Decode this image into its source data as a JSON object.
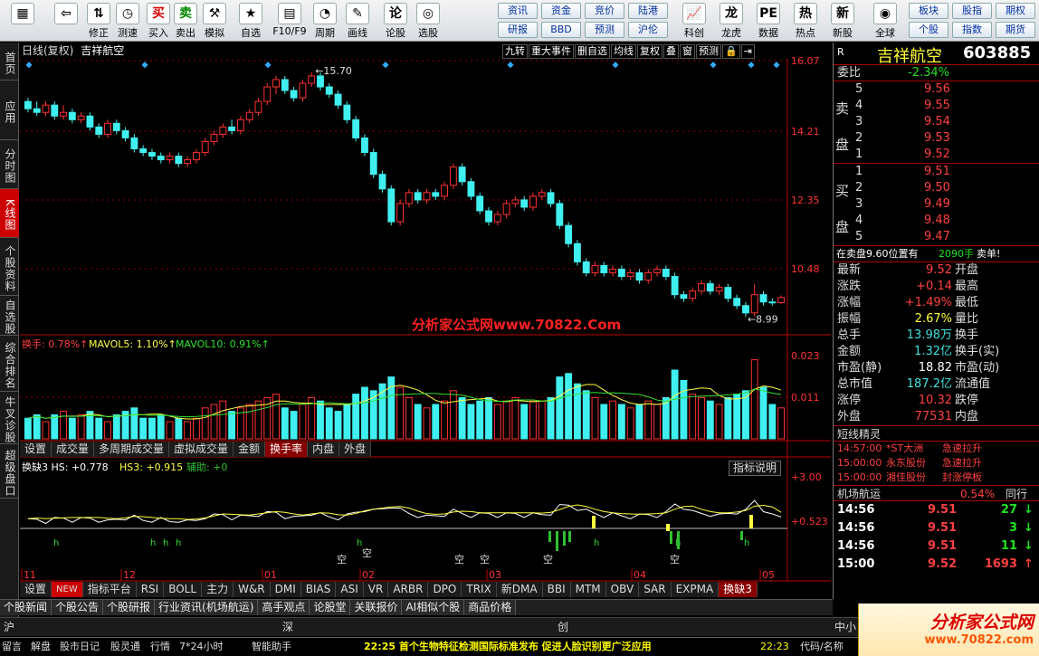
{
  "toolbar": {
    "buttons": [
      {
        "label": "",
        "icon": "grid-icon"
      },
      {
        "label": "",
        "icon": "back-icon"
      },
      {
        "label": "修正",
        "icon": "up-down-icon"
      },
      {
        "label": "测速",
        "icon": "clock-icon"
      },
      {
        "label": "买入",
        "icon": "buy-icon"
      },
      {
        "label": "卖出",
        "icon": "sell-icon"
      },
      {
        "label": "模拟",
        "icon": "hammer-icon"
      },
      {
        "label": "自选",
        "icon": "star-icon"
      },
      {
        "label": "F10/F9",
        "icon": "f10-icon"
      },
      {
        "label": "周期",
        "icon": "cycle-icon"
      },
      {
        "label": "画线",
        "icon": "pencil-icon"
      },
      {
        "label": "论股",
        "icon": "talk-icon"
      },
      {
        "label": "选股",
        "icon": "filter-icon"
      }
    ],
    "small": [
      "资讯",
      "资金",
      "竞价",
      "陆港",
      "研报",
      "BBD",
      "预测",
      "沪伦"
    ],
    "right_buttons": [
      {
        "label": "科创",
        "icon": "chart-icon"
      },
      {
        "label": "龙虎",
        "icon": "dragon-icon"
      },
      {
        "label": "数据",
        "icon": "pe-icon"
      },
      {
        "label": "热点",
        "icon": "hot-icon"
      },
      {
        "label": "新股",
        "icon": "ipo-icon"
      },
      {
        "label": "全球",
        "icon": "globe-icon"
      }
    ],
    "far": [
      "板块",
      "股指",
      "期权",
      "个股",
      "指数",
      "期货"
    ]
  },
  "leftbar": [
    "首页",
    "应用",
    "分时图",
    "K线图",
    "个股资料",
    "自选股",
    "综合排名",
    "牛叉诊股",
    "超级盘口"
  ],
  "kline": {
    "period": "日线(复权)",
    "name": "吉祥航空",
    "buttons": [
      "九转",
      "重大事件",
      "删自选",
      "均线",
      "复权",
      "叠",
      "窗",
      "预测"
    ],
    "high_label": "15.70",
    "low_label": "8.99",
    "yaxis": [
      "16.07",
      "14.21",
      "12.35",
      "10.48"
    ]
  },
  "turnover": {
    "title": "换手: 0.78%",
    "mavol5": "MAVOL5: 1.10%",
    "mavol10": "MAVOL10: 0.91%",
    "yaxis": [
      "0.023",
      "0.011"
    ]
  },
  "volume_tabs": [
    "设置",
    "成交量",
    "多周期成交量",
    "虚拟成交量",
    "金额",
    "换手率",
    "内盘",
    "外盘"
  ],
  "indicator": {
    "title": "换缺3 HS: +0.778",
    "hs3": "HS3: +0.915",
    "aux": "辅助: +0",
    "button": "指标说明",
    "yaxis": [
      "+3.00",
      "+0.523"
    ],
    "marks": [
      "空",
      "空",
      "空",
      "空",
      "空"
    ],
    "x_axis": [
      "11",
      "12",
      "01",
      "02",
      "03",
      "04",
      "05"
    ]
  },
  "indicator_tabs": [
    "设置",
    "NEW",
    "指标平台",
    "RSI",
    "BOLL",
    "主力",
    "W&R",
    "DMI",
    "BIAS",
    "ASI",
    "VR",
    "ARBR",
    "DPO",
    "TRIX",
    "新DMA",
    "BBI",
    "MTM",
    "OBV",
    "SAR",
    "EXPMA",
    "换缺3"
  ],
  "bottom_tabs": [
    "个股新闻",
    "个股公告",
    "个股研报",
    "行业资讯(机场航运)",
    "高手观点",
    "论股堂",
    "关联报价",
    "AI相似个股",
    "商品价格"
  ],
  "watermark": "分析家公式网www.70822.Com",
  "stock": {
    "title": "吉祥航空",
    "code": "603885",
    "wb_label": "委比",
    "wb": "-2.34%",
    "sell": [
      [
        "5",
        "9.56"
      ],
      [
        "4",
        "9.55"
      ],
      [
        "3",
        "9.54"
      ],
      [
        "2",
        "9.53"
      ],
      [
        "1",
        "9.52"
      ]
    ],
    "buy": [
      [
        "1",
        "9.51"
      ],
      [
        "2",
        "9.50"
      ],
      [
        "3",
        "9.49"
      ],
      [
        "4",
        "9.48"
      ],
      [
        "5",
        "9.47"
      ]
    ],
    "sell_side": "卖盘",
    "buy_side": "买盘",
    "sellbar": "在卖盘9.60位置有",
    "sellbar_qty": "2090手",
    "sellbar_action": "卖单!"
  },
  "quote": [
    {
      "k": "最新",
      "v": "9.52",
      "c": "red",
      "k2": "开盘"
    },
    {
      "k": "涨跌",
      "v": "+0.14",
      "c": "red",
      "k2": "最高"
    },
    {
      "k": "涨幅",
      "v": "+1.49%",
      "c": "red",
      "k2": "最低"
    },
    {
      "k": "振幅",
      "v": "2.67%",
      "c": "yel",
      "k2": "量比"
    },
    {
      "k": "总手",
      "v": "13.98万",
      "c": "cyan",
      "k2": "换手"
    },
    {
      "k": "金额",
      "v": "1.32亿",
      "c": "cyan",
      "k2": "换手(实)"
    },
    {
      "k": "市盈(静)",
      "v": "18.82",
      "c": "white",
      "k2": "市盈(动)"
    },
    {
      "k": "总市值",
      "v": "187.2亿",
      "c": "cyan",
      "k2": "流通值"
    },
    {
      "k": "涨停",
      "v": "10.32",
      "c": "red",
      "k2": "跌停"
    },
    {
      "k": "外盘",
      "v": "77531",
      "c": "red",
      "k2": "内盘"
    }
  ],
  "news": {
    "title": "短线精灵",
    "items": [
      [
        "14:57:00",
        "*ST大洲",
        "急速拉升"
      ],
      [
        "15:00:00",
        "永东股份",
        "急速拉升"
      ],
      [
        "15:00:00",
        "湘佳股份",
        "封涨停板"
      ]
    ]
  },
  "sector": {
    "label": "机场航运",
    "value": "0.54%",
    "extra": "同行"
  },
  "ticks": [
    [
      "14:56",
      "9.51",
      "27",
      "down"
    ],
    [
      "14:56",
      "9.51",
      "3",
      "down"
    ],
    [
      "14:56",
      "9.51",
      "11",
      "down"
    ],
    [
      "15:00",
      "9.52",
      "1693",
      "up"
    ]
  ],
  "market": {
    "sh": "沪",
    "sz": "深",
    "cy": "创",
    "zx": "中小"
  },
  "status": {
    "items": [
      "留言",
      "解盘",
      "股市日记",
      "股灵通",
      "行情",
      "7*24小时",
      "智能助手"
    ],
    "news": "22:25 首个生物特征检测国际标准发布 促进人脸识别更广泛应用",
    "time": "22:23",
    "code_label": "代码/名称"
  },
  "logo": {
    "text": "分析家公式网",
    "url": "www.70822.com"
  },
  "chart_data": {
    "type": "candlestick",
    "note_high": "15.70",
    "note_low": "8.99",
    "yrange": [
      8.5,
      16.07
    ],
    "candles": [
      [
        14.9,
        14.7,
        15.0,
        14.6
      ],
      [
        14.7,
        14.6,
        14.9,
        14.5
      ],
      [
        14.6,
        14.8,
        14.9,
        14.5
      ],
      [
        14.8,
        14.5,
        14.9,
        14.4
      ],
      [
        14.5,
        14.6,
        14.8,
        14.4
      ],
      [
        14.6,
        14.4,
        14.7,
        14.3
      ],
      [
        14.4,
        14.5,
        14.6,
        14.3
      ],
      [
        14.5,
        14.2,
        14.6,
        14.1
      ],
      [
        14.2,
        14.0,
        14.3,
        13.9
      ],
      [
        14.0,
        14.3,
        14.4,
        13.9
      ],
      [
        14.3,
        14.1,
        14.4,
        14.0
      ],
      [
        14.1,
        13.9,
        14.2,
        13.8
      ],
      [
        13.9,
        13.6,
        14.0,
        13.5
      ],
      [
        13.6,
        13.5,
        13.7,
        13.4
      ],
      [
        13.5,
        13.4,
        13.6,
        13.3
      ],
      [
        13.4,
        13.3,
        13.5,
        13.2
      ],
      [
        13.3,
        13.4,
        13.5,
        13.2
      ],
      [
        13.4,
        13.2,
        13.5,
        13.1
      ],
      [
        13.2,
        13.3,
        13.4,
        13.1
      ],
      [
        13.3,
        13.5,
        13.6,
        13.2
      ],
      [
        13.5,
        13.8,
        13.9,
        13.4
      ],
      [
        13.8,
        14.0,
        14.1,
        13.7
      ],
      [
        14.0,
        14.2,
        14.3,
        13.9
      ],
      [
        14.2,
        14.1,
        14.4,
        14.0
      ],
      [
        14.1,
        14.4,
        14.5,
        14.0
      ],
      [
        14.4,
        14.6,
        14.7,
        14.3
      ],
      [
        14.6,
        14.9,
        15.0,
        14.5
      ],
      [
        14.9,
        15.3,
        15.4,
        14.8
      ],
      [
        15.3,
        15.5,
        15.6,
        15.1
      ],
      [
        15.5,
        15.2,
        15.6,
        15.1
      ],
      [
        15.2,
        15.0,
        15.3,
        14.9
      ],
      [
        15.0,
        15.4,
        15.5,
        14.9
      ],
      [
        15.4,
        15.6,
        15.7,
        15.3
      ],
      [
        15.6,
        15.3,
        15.7,
        15.2
      ],
      [
        15.3,
        15.1,
        15.4,
        15.0
      ],
      [
        15.1,
        14.8,
        15.2,
        14.7
      ],
      [
        14.8,
        14.4,
        14.9,
        14.3
      ],
      [
        14.4,
        13.9,
        14.5,
        13.8
      ],
      [
        13.9,
        13.5,
        14.0,
        13.4
      ],
      [
        13.5,
        12.9,
        13.6,
        12.8
      ],
      [
        12.9,
        12.5,
        13.0,
        12.4
      ],
      [
        12.5,
        11.6,
        12.6,
        11.5
      ],
      [
        11.6,
        12.1,
        12.2,
        11.5
      ],
      [
        12.1,
        12.4,
        12.5,
        12.0
      ],
      [
        12.4,
        12.2,
        12.5,
        12.1
      ],
      [
        12.2,
        12.4,
        12.5,
        12.1
      ],
      [
        12.4,
        12.3,
        12.5,
        12.2
      ],
      [
        12.3,
        12.6,
        12.7,
        12.2
      ],
      [
        12.6,
        13.1,
        13.2,
        12.5
      ],
      [
        13.1,
        12.7,
        13.2,
        12.6
      ],
      [
        12.7,
        12.3,
        12.8,
        12.2
      ],
      [
        12.3,
        11.9,
        12.4,
        11.8
      ],
      [
        11.9,
        11.6,
        12.0,
        11.5
      ],
      [
        11.6,
        11.8,
        11.9,
        11.5
      ],
      [
        11.8,
        12.1,
        12.2,
        11.7
      ],
      [
        12.1,
        12.2,
        12.3,
        12.0
      ],
      [
        12.2,
        12.0,
        12.3,
        11.9
      ],
      [
        12.0,
        12.3,
        12.4,
        11.9
      ],
      [
        12.3,
        12.4,
        12.5,
        12.2
      ],
      [
        12.4,
        12.1,
        12.5,
        12.0
      ],
      [
        12.1,
        11.5,
        12.2,
        11.4
      ],
      [
        11.5,
        11.0,
        11.6,
        10.9
      ],
      [
        11.0,
        10.5,
        11.1,
        10.4
      ],
      [
        10.5,
        10.2,
        10.6,
        10.1
      ],
      [
        10.2,
        10.4,
        10.5,
        10.1
      ],
      [
        10.4,
        10.2,
        10.5,
        10.1
      ],
      [
        10.2,
        10.3,
        10.4,
        10.1
      ],
      [
        10.3,
        10.1,
        10.4,
        10.0
      ],
      [
        10.1,
        10.2,
        10.3,
        10.0
      ],
      [
        10.2,
        10.0,
        10.3,
        9.9
      ],
      [
        10.0,
        10.2,
        10.3,
        9.9
      ],
      [
        10.2,
        10.3,
        10.4,
        10.1
      ],
      [
        10.3,
        10.1,
        10.4,
        10.0
      ],
      [
        10.1,
        9.6,
        10.2,
        9.5
      ],
      [
        9.6,
        9.5,
        9.7,
        9.4
      ],
      [
        9.5,
        9.7,
        9.8,
        9.4
      ],
      [
        9.7,
        9.9,
        10.0,
        9.6
      ],
      [
        9.9,
        9.7,
        10.0,
        9.6
      ],
      [
        9.7,
        9.8,
        9.9,
        9.6
      ],
      [
        9.8,
        9.5,
        9.9,
        9.4
      ],
      [
        9.5,
        9.3,
        9.6,
        9.2
      ],
      [
        9.3,
        9.1,
        9.4,
        8.99
      ],
      [
        9.1,
        9.6,
        9.9,
        9.0
      ],
      [
        9.6,
        9.4,
        9.7,
        9.3
      ],
      [
        9.4,
        9.38,
        9.5,
        9.3
      ],
      [
        9.38,
        9.52,
        9.58,
        9.35
      ]
    ],
    "turnover": [
      0.006,
      0.007,
      0.005,
      0.007,
      0.008,
      0.006,
      0.007,
      0.008,
      0.006,
      0.005,
      0.007,
      0.008,
      0.009,
      0.006,
      0.006,
      0.007,
      0.005,
      0.006,
      0.005,
      0.006,
      0.009,
      0.01,
      0.011,
      0.008,
      0.009,
      0.01,
      0.011,
      0.012,
      0.013,
      0.009,
      0.008,
      0.01,
      0.012,
      0.011,
      0.009,
      0.008,
      0.01,
      0.013,
      0.015,
      0.014,
      0.016,
      0.018,
      0.015,
      0.012,
      0.01,
      0.009,
      0.01,
      0.011,
      0.014,
      0.012,
      0.01,
      0.011,
      0.012,
      0.01,
      0.011,
      0.012,
      0.01,
      0.011,
      0.011,
      0.012,
      0.018,
      0.019,
      0.016,
      0.014,
      0.012,
      0.01,
      0.011,
      0.01,
      0.009,
      0.01,
      0.011,
      0.01,
      0.012,
      0.02,
      0.017,
      0.013,
      0.012,
      0.011,
      0.01,
      0.012,
      0.013,
      0.014,
      0.023,
      0.015,
      0.01,
      0.009
    ]
  }
}
